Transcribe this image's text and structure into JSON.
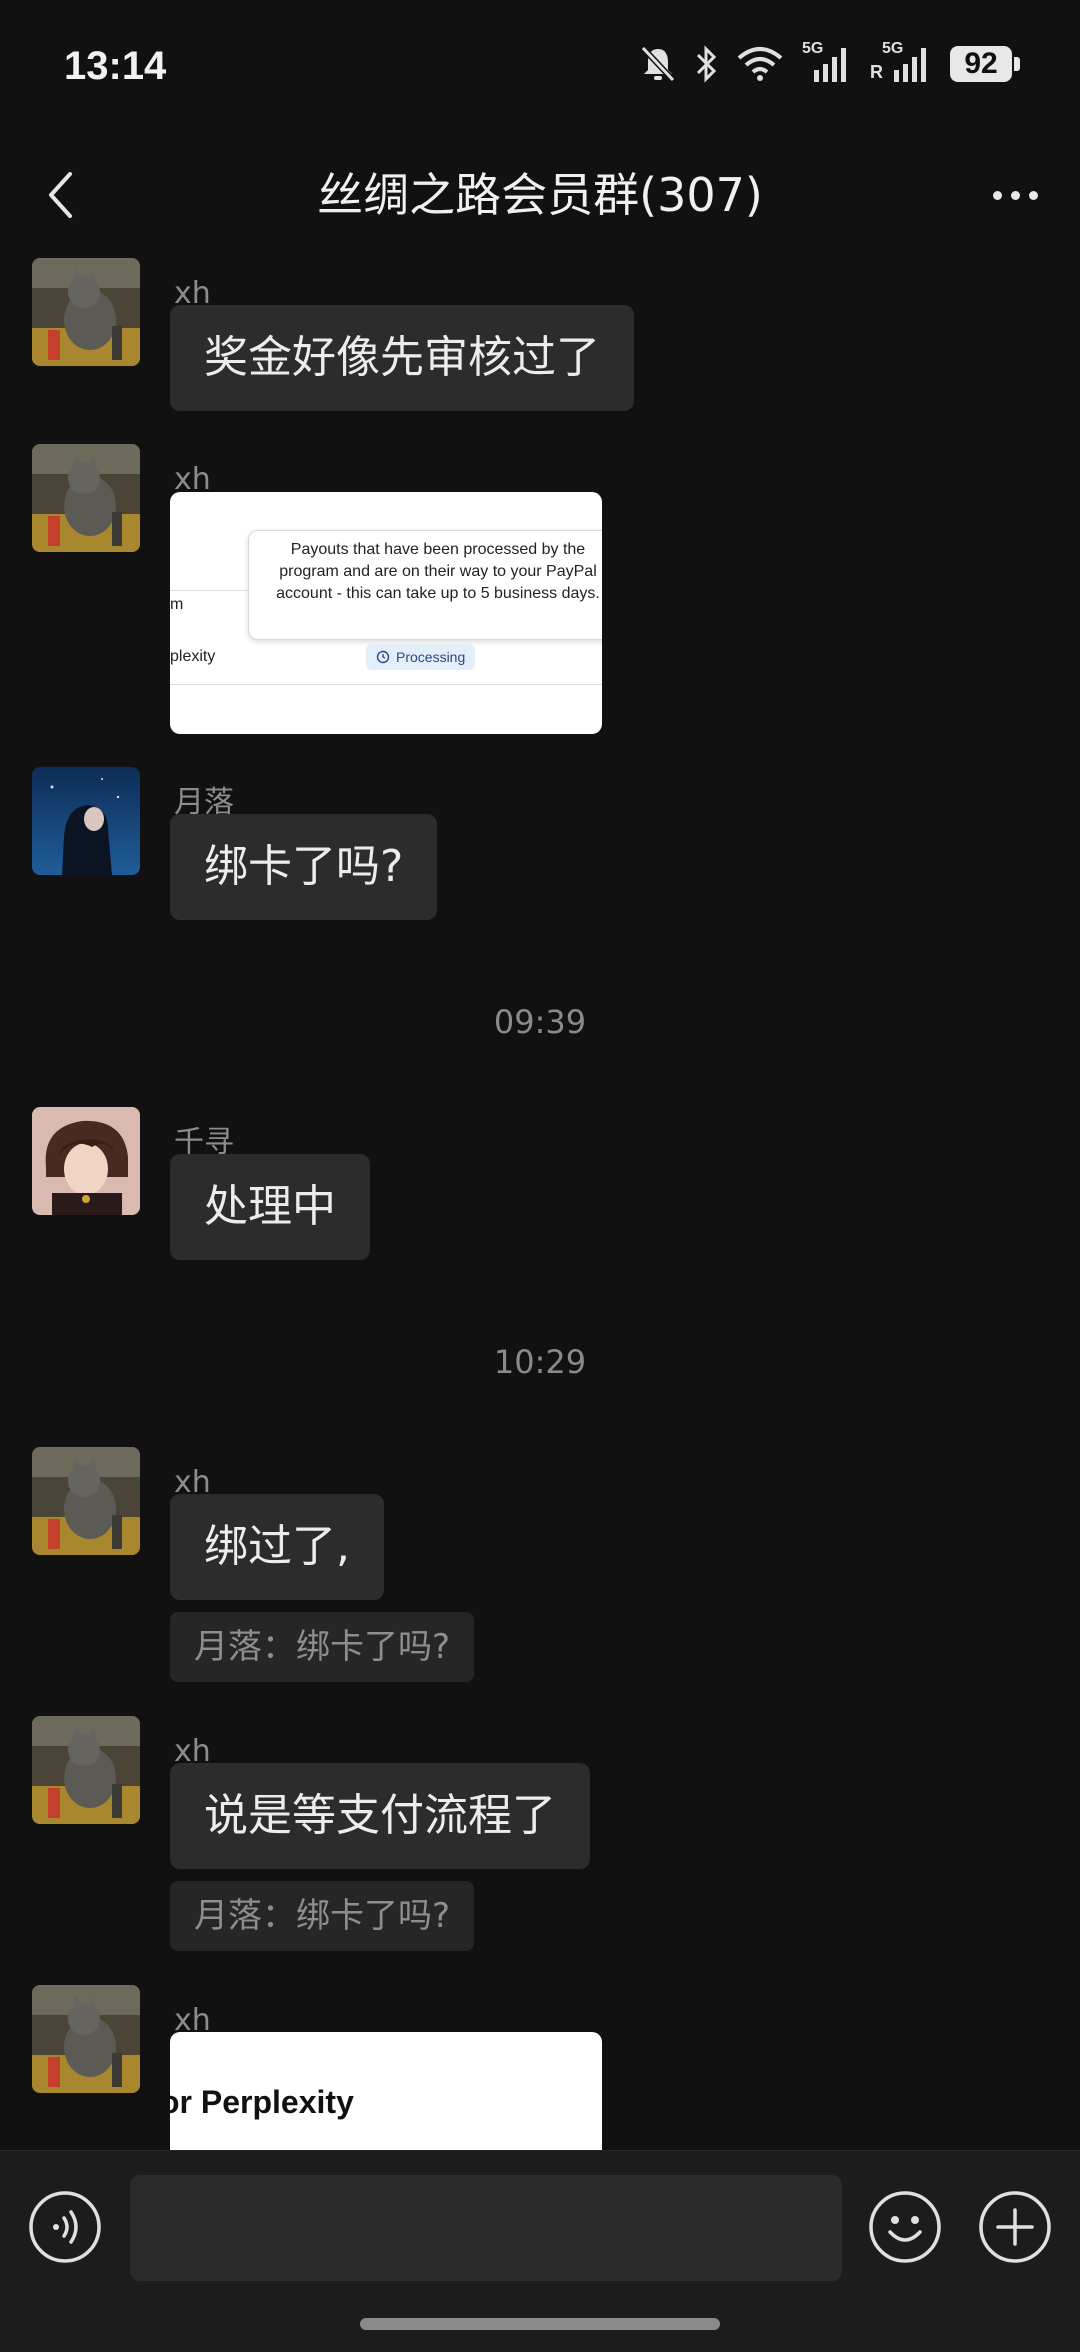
{
  "status_bar": {
    "time": "13:14",
    "network_1": "5G",
    "network_2": "5G",
    "roaming": "R",
    "battery": "92"
  },
  "header": {
    "title": "丝绸之路会员群(307)",
    "back_icon": "chevron-left-icon",
    "more_icon": "more-dots-icon"
  },
  "messages": [
    {
      "sender": "xh",
      "text": "奖金好像先审核过了"
    },
    {
      "sender": "xh",
      "image": {
        "tooltip": "Payouts that have been processed by the program and are on their way to your PayPal account - this can take up to 5 business days.",
        "fragment_left": "m",
        "row_label": "plexity",
        "badge": "Processing"
      }
    },
    {
      "sender": "月落",
      "text": "绑卡了吗?"
    },
    {
      "timestamp": "09:39"
    },
    {
      "sender": "千寻",
      "text": "处理中"
    },
    {
      "timestamp": "10:29"
    },
    {
      "sender": "xh",
      "text": "绑过了,",
      "quote": "月落：绑卡了吗?"
    },
    {
      "sender": "xh",
      "text": "说是等支付流程了",
      "quote": "月落：绑卡了吗?"
    },
    {
      "sender": "xh",
      "image": {
        "heading": "or Perplexity"
      }
    }
  ],
  "input_bar": {
    "placeholder": "",
    "voice_icon": "voice-icon",
    "emoji_icon": "emoji-icon",
    "plus_icon": "plus-icon"
  },
  "colors": {
    "background": "#111111",
    "bubble": "#2c2c2c",
    "input_bar": "#1c1c1c"
  }
}
